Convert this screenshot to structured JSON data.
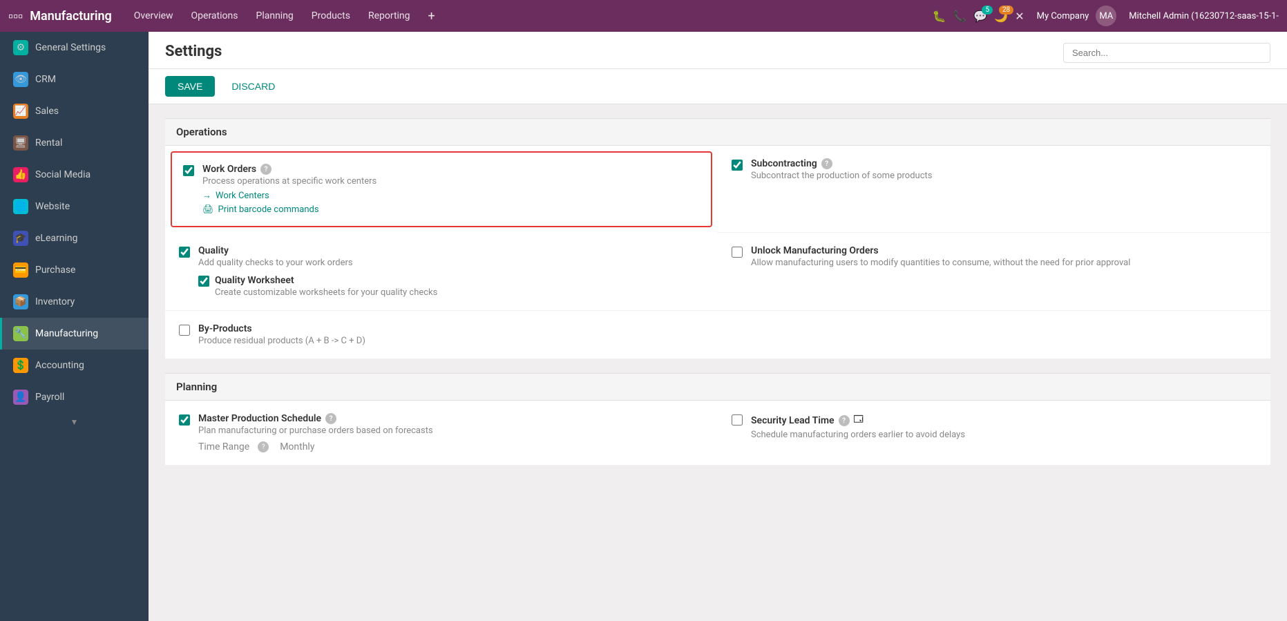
{
  "topnav": {
    "app_name": "Manufacturing",
    "nav_links": [
      "Overview",
      "Operations",
      "Planning",
      "Products",
      "Reporting"
    ],
    "company": "My Company",
    "user": "Mitchell Admin (16230712-saas-15-1-",
    "badge_messages": "5",
    "badge_activity": "28"
  },
  "sidebar": {
    "items": [
      {
        "id": "general-settings",
        "label": "General Settings",
        "icon": "⚙",
        "color": "teal"
      },
      {
        "id": "crm",
        "label": "CRM",
        "icon": "👁",
        "color": "blue"
      },
      {
        "id": "sales",
        "label": "Sales",
        "icon": "📈",
        "color": "orange"
      },
      {
        "id": "rental",
        "label": "Rental",
        "icon": "🖥",
        "color": "brown"
      },
      {
        "id": "social-media",
        "label": "Social Media",
        "icon": "👍",
        "color": "pink"
      },
      {
        "id": "website",
        "label": "Website",
        "icon": "🌐",
        "color": "cyan"
      },
      {
        "id": "elearning",
        "label": "eLearning",
        "icon": "🎓",
        "color": "indigo"
      },
      {
        "id": "purchase",
        "label": "Purchase",
        "icon": "💳",
        "color": "amber"
      },
      {
        "id": "inventory",
        "label": "Inventory",
        "icon": "📦",
        "color": "blue"
      },
      {
        "id": "manufacturing",
        "label": "Manufacturing",
        "icon": "🔧",
        "color": "lime",
        "active": true
      },
      {
        "id": "accounting",
        "label": "Accounting",
        "icon": "💲",
        "color": "amber"
      },
      {
        "id": "payroll",
        "label": "Payroll",
        "icon": "👤",
        "color": "purple"
      }
    ]
  },
  "page": {
    "title": "Settings",
    "search_placeholder": "Search...",
    "save_label": "SAVE",
    "discard_label": "DISCARD"
  },
  "sections": {
    "operations": {
      "title": "Operations",
      "items": [
        {
          "id": "work-orders",
          "label": "Work Orders",
          "checked": true,
          "highlighted": true,
          "desc": "Process operations at specific work centers",
          "links": [
            {
              "id": "work-centers",
              "text": "Work Centers",
              "icon": "→"
            },
            {
              "id": "print-barcode",
              "text": "Print barcode commands",
              "icon": "🖨"
            }
          ]
        },
        {
          "id": "subcontracting",
          "label": "Subcontracting",
          "checked": true,
          "highlighted": false,
          "desc": "Subcontract the production of some products",
          "links": []
        },
        {
          "id": "quality",
          "label": "Quality",
          "checked": true,
          "highlighted": false,
          "desc": "Add quality checks to your work orders",
          "sub": {
            "id": "quality-worksheet",
            "label": "Quality Worksheet",
            "checked": true,
            "desc": "Create customizable worksheets for your quality checks"
          },
          "links": []
        },
        {
          "id": "unlock-manufacturing",
          "label": "Unlock Manufacturing Orders",
          "checked": false,
          "highlighted": false,
          "desc": "Allow manufacturing users to modify quantities to consume, without the need for prior approval",
          "links": []
        },
        {
          "id": "by-products",
          "label": "By-Products",
          "checked": false,
          "highlighted": false,
          "desc": "Produce residual products (A + B -> C + D)",
          "links": []
        },
        {
          "id": "empty-right-bottom",
          "label": "",
          "checked": false,
          "desc": "",
          "links": []
        }
      ]
    },
    "planning": {
      "title": "Planning",
      "items": [
        {
          "id": "master-production-schedule",
          "label": "Master Production Schedule",
          "checked": true,
          "desc": "Plan manufacturing or purchase orders based on forecasts",
          "sub_label": "Time Range",
          "sub_desc": "Monthly",
          "links": []
        },
        {
          "id": "security-lead-time",
          "label": "Security Lead Time",
          "checked": false,
          "desc": "Schedule manufacturing orders earlier to avoid delays",
          "links": []
        }
      ]
    }
  }
}
